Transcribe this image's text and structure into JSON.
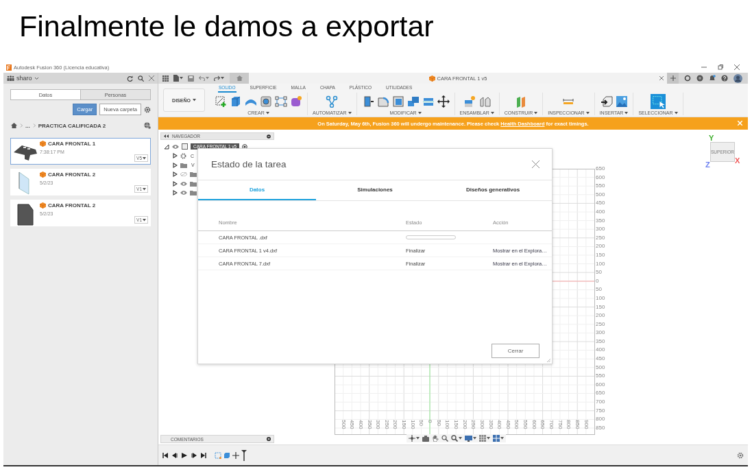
{
  "slide": {
    "title": "Finalmente le damos a exportar"
  },
  "window": {
    "title": "Autodesk Fusion 360 (Licencia educativa)"
  },
  "data_panel": {
    "user": "sharo",
    "tabs": [
      {
        "label": "Datos",
        "selected": true
      },
      {
        "label": "Personas",
        "selected": false
      }
    ],
    "buttons": [
      {
        "label": "Cargar",
        "kind": "primary"
      },
      {
        "label": "Nueva carpeta",
        "kind": "secondary"
      }
    ],
    "breadcrumb": [
      "...",
      "PRACTICA CALIFICADA 2"
    ],
    "files": [
      {
        "name": "CARA FRONTAL 1",
        "date": "7:38:17 PM",
        "version": "V5",
        "selected": true
      },
      {
        "name": "CARA FRONTAL 2",
        "date": "5/2/23",
        "version": "V1",
        "selected": false
      },
      {
        "name": "CARA FRONTAL 2",
        "date": "5/2/23",
        "version": "V1",
        "selected": false
      }
    ]
  },
  "document_tab": {
    "title": "CARA FRONTAL 1 v5"
  },
  "toolbar": {
    "workspace": "DISEÑO",
    "tabs": [
      {
        "label": "SOLIDO",
        "selected": true
      },
      {
        "label": "SUPERFICIE",
        "selected": false
      },
      {
        "label": "MALLA",
        "selected": false
      },
      {
        "label": "CHAPA",
        "selected": false
      },
      {
        "label": "PLÁSTICO",
        "selected": false
      },
      {
        "label": "UTILIDADES",
        "selected": false
      }
    ],
    "groups": [
      "CREAR",
      "AUTOMATIZAR",
      "MODIFICAR",
      "ENSAMBLAR",
      "CONSTRUIR",
      "INSPECCIONAR",
      "INSERTAR",
      "SELECCIONAR"
    ]
  },
  "banner": {
    "message": "On Saturday, May 6th, Fusion 360 will undergo maintenance. Please check",
    "link": "Health Dashboard",
    "message_end": "for exact timings."
  },
  "navigator": {
    "title": "NAVEGADOR",
    "tree": [
      {
        "label": "CARA FRONTAL 1 v5",
        "expanded": true,
        "selected": true,
        "children": [
          {
            "kind": "settings",
            "label": "C",
            "expanded": false,
            "selected": false
          },
          {
            "kind": "folder",
            "label": "V",
            "expanded": false,
            "selected": false
          },
          {
            "kind": "folder",
            "visible": false,
            "expanded": false
          },
          {
            "kind": "folder",
            "visible": true,
            "expanded": false
          },
          {
            "kind": "folder",
            "visible": true,
            "expanded": false
          }
        ]
      }
    ]
  },
  "viewcube": {
    "face": "SUPERIOR",
    "axes": [
      {
        "label": "Y",
        "color": "#3fae2e"
      },
      {
        "label": "Z",
        "color": "#6b7ff0"
      },
      {
        "label": "X",
        "color": "#f05a5a"
      }
    ]
  },
  "ruler": {
    "y_labels": [
      "650",
      "600",
      "550",
      "500",
      "450",
      "400",
      "350",
      "300",
      "250",
      "200",
      "150",
      "100",
      "50",
      "0",
      "50",
      "100",
      "150",
      "200",
      "250",
      "300",
      "350",
      "400",
      "450",
      "500",
      "550",
      "600",
      "650",
      "700",
      "750",
      "800",
      "850"
    ],
    "x_labels": [
      "500",
      "450",
      "400",
      "350",
      "300",
      "250",
      "200",
      "150",
      "100",
      "50",
      "0",
      "50",
      "100",
      "150",
      "200",
      "250",
      "300",
      "350",
      "400",
      "450",
      "500",
      "550",
      "600",
      "650",
      "700",
      "750",
      "800",
      "850",
      "900"
    ]
  },
  "dialog": {
    "title": "Estado de la tarea",
    "tabs": [
      {
        "label": "Datos",
        "selected": true
      },
      {
        "label": "Simulaciones",
        "selected": false
      },
      {
        "label": "Diseños generativos",
        "selected": false
      }
    ],
    "columns": [
      "Nombre",
      "Estado",
      "Acción"
    ],
    "rows": [
      {
        "kind": "progress",
        "name": "CARA FRONTAL .dxf",
        "level": 0
      },
      {
        "kind": "done",
        "name": "CARA FRONTAL 1 v4.dxf",
        "status": "Finalizar",
        "action": "Mostrar en el Explora…"
      },
      {
        "kind": "done",
        "name": "CARA FRONTAL 7.dxf",
        "status": "Finalizar",
        "action": "Mostrar en el Explora…"
      }
    ],
    "button": "Cerrar"
  },
  "comments": {
    "title": "COMENTARIOS"
  }
}
